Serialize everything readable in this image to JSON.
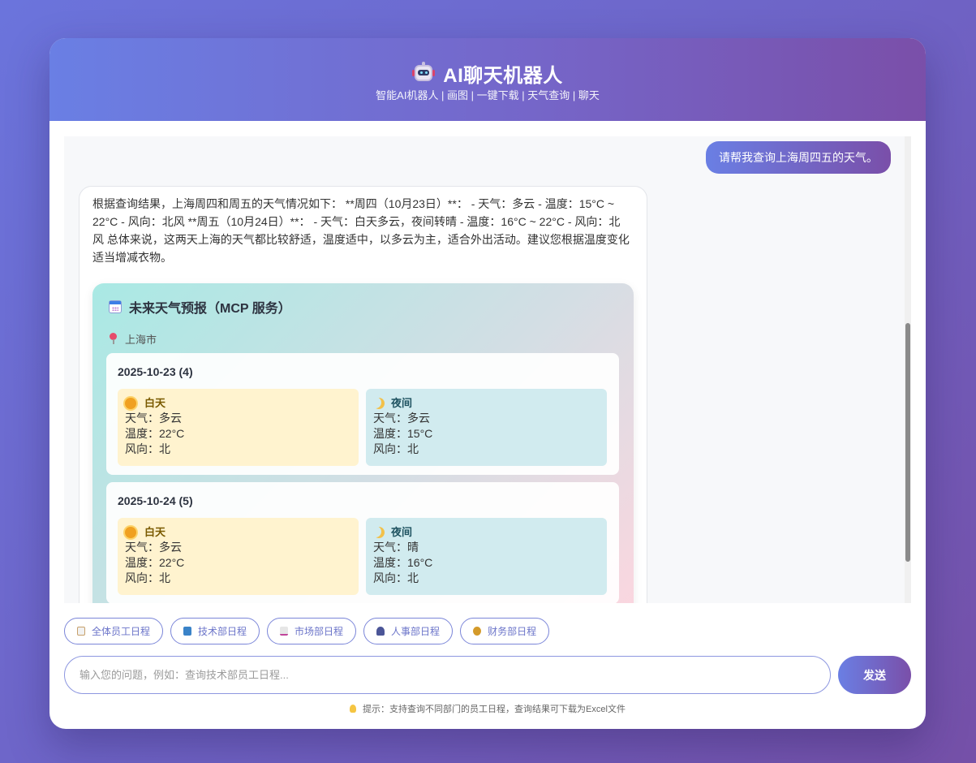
{
  "header": {
    "title": "AI聊天机器人",
    "subtitle": "智能AI机器人 | 画图 | 一键下载 | 天气查询 | 聊天",
    "icon": "robot-icon"
  },
  "chat": {
    "user_message": "请帮我查询上海周四五的天气。",
    "bot_message": "根据查询结果，上海周四和周五的天气情况如下： **周四（10月23日）**： - 天气：多云 - 温度：15°C ~ 22°C - 风向：北风 **周五（10月24日）**： - 天气：白天多云，夜间转晴 - 温度：16°C ~ 22°C - 风向：北风 总体来说，这两天上海的天气都比较舒适，温度适中，以多云为主，适合外出活动。建议您根据温度变化适当增减衣物。",
    "weather_card": {
      "title": "未来天气预报（MCP 服务）",
      "location": "上海市",
      "days": [
        {
          "date": "2025-10-23 (4)",
          "day": {
            "label": "白天",
            "weather": "天气：多云",
            "temp": "温度：22°C",
            "wind": "风向：北"
          },
          "night": {
            "label": "夜间",
            "weather": "天气：多云",
            "temp": "温度：15°C",
            "wind": "风向：北"
          }
        },
        {
          "date": "2025-10-24 (5)",
          "day": {
            "label": "白天",
            "weather": "天气：多云",
            "temp": "温度：22°C",
            "wind": "风向：北"
          },
          "night": {
            "label": "夜间",
            "weather": "天气：晴",
            "temp": "温度：16°C",
            "wind": "风向：北"
          }
        }
      ]
    }
  },
  "quick_actions": [
    {
      "label": "全体员工日程",
      "icon": "clipboard-icon"
    },
    {
      "label": "技术部日程",
      "icon": "book-icon"
    },
    {
      "label": "市场部日程",
      "icon": "chart-icon"
    },
    {
      "label": "人事部日程",
      "icon": "people-icon"
    },
    {
      "label": "财务部日程",
      "icon": "money-bag-icon"
    }
  ],
  "input": {
    "placeholder": "输入您的问题，例如：查询技术部员工日程...",
    "value": ""
  },
  "send_label": "发送",
  "hint": "提示：支持查询不同部门的员工日程，查询结果可下载为Excel文件",
  "colors": {
    "accent_start": "#6a7fe4",
    "accent_end": "#7a4fa9",
    "day_bg": "#fff3cf",
    "night_bg": "#d1ebef"
  }
}
